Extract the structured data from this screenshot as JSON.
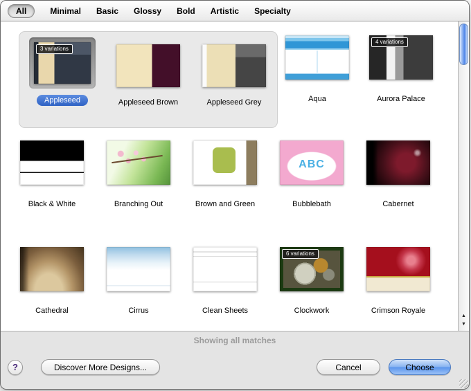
{
  "tabs": [
    {
      "label": "All",
      "selected": true
    },
    {
      "label": "Minimal"
    },
    {
      "label": "Basic"
    },
    {
      "label": "Glossy"
    },
    {
      "label": "Bold"
    },
    {
      "label": "Artistic"
    },
    {
      "label": "Specialty"
    }
  ],
  "themes": [
    {
      "name": "Appleseed",
      "badge": "3 variations",
      "selected": true
    },
    {
      "name": "Appleseed Brown"
    },
    {
      "name": "Appleseed Grey"
    },
    {
      "name": "Aqua"
    },
    {
      "name": "Aurora Palace",
      "badge": "4 variations"
    },
    {
      "name": "Black & White"
    },
    {
      "name": "Branching Out"
    },
    {
      "name": "Brown and Green"
    },
    {
      "name": "Bubblebath",
      "art": "ABC"
    },
    {
      "name": "Cabernet"
    },
    {
      "name": "Cathedral"
    },
    {
      "name": "Cirrus"
    },
    {
      "name": "Clean Sheets"
    },
    {
      "name": "Clockwork",
      "badge": "6 variations"
    },
    {
      "name": "Crimson Royale"
    }
  ],
  "status": "Showing all matches",
  "footer": {
    "help": "?",
    "discover": "Discover More Designs...",
    "cancel": "Cancel",
    "choose": "Choose"
  },
  "scrollbar": {
    "up": "▲",
    "down": "▼"
  },
  "colors": {
    "selection_blue": "#3b77d8",
    "choose_blue": "#86b2f0"
  }
}
